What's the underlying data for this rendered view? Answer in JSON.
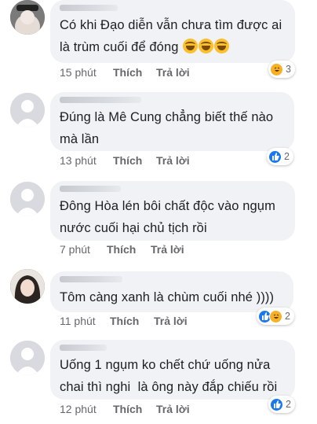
{
  "comments": [
    {
      "text_lines": [
        "Có khi Đạo diễn vẫn chưa tìm được ai",
        "là trùm cuối để đóng"
      ],
      "trailing_emoji": [
        "grinning-face",
        "grinning-face",
        "grinning-face"
      ],
      "time": "15 phút",
      "like_label": "Thích",
      "reply_label": "Trả lời",
      "reactions": [
        "haha"
      ],
      "reaction_count": "3"
    },
    {
      "text_lines": [
        "Đúng là Mê Cung chẳng biết thế nào",
        "mà lần"
      ],
      "time": "13 phút",
      "like_label": "Thích",
      "reply_label": "Trả lời",
      "reactions": [
        "like"
      ],
      "reaction_count": "2"
    },
    {
      "text_lines": [
        "Đông Hòa lén bôi chất độc vào ngụm",
        "nước cuối hại chủ tịch rồi"
      ],
      "time": "7 phút",
      "like_label": "Thích",
      "reply_label": "Trả lời"
    },
    {
      "text_lines": [
        "Tôm càng xanh là chùm cuối nhé ))))"
      ],
      "time": "11 phút",
      "like_label": "Thích",
      "reply_label": "Trả lời",
      "reactions": [
        "like",
        "haha"
      ],
      "reaction_count": "2"
    },
    {
      "text_lines": [
        "Uống 1 ngụm ko chết chứ uống nửa",
        "chai thì nghi  là ông này đắp chiếu rồi"
      ],
      "time": "12 phút",
      "like_label": "Thích",
      "reply_label": "Trả lời",
      "reactions": [
        "like"
      ],
      "reaction_count": "2"
    }
  ],
  "colors": {
    "bubble": "#f0f2f5",
    "meta_text": "#65676b",
    "like_blue": "#1877f2",
    "haha_yellow": "#f7b125"
  }
}
